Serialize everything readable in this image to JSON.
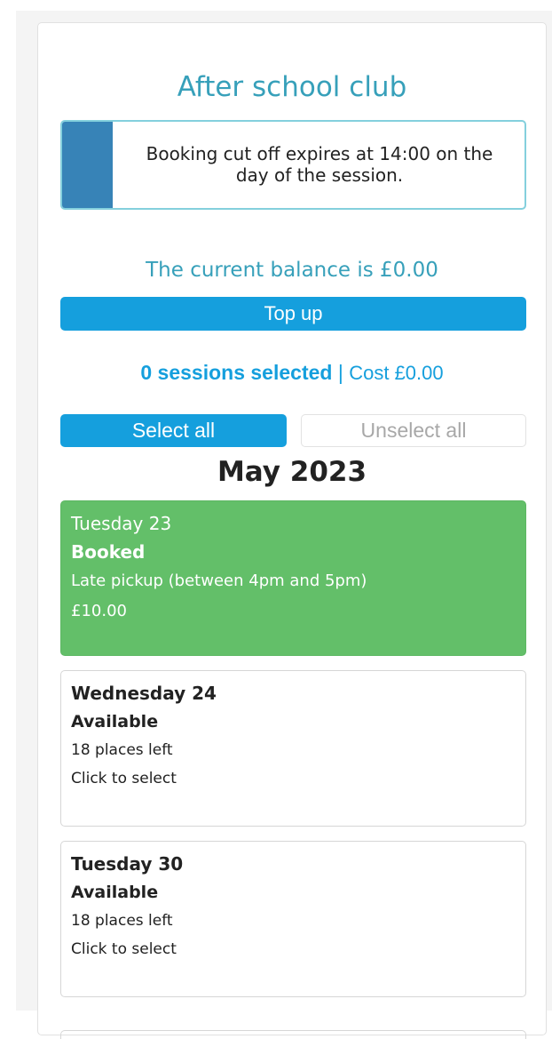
{
  "page": {
    "title": "After school club"
  },
  "notice": {
    "text": "Booking cut off expires at 14:00 on the day of the session."
  },
  "balance": {
    "text": "The current balance is £0.00",
    "topup_label": "Top up"
  },
  "summary": {
    "selected": "0 sessions selected",
    "separator": " | ",
    "cost": "Cost £0.00"
  },
  "actions": {
    "select_all": "Select all",
    "unselect_all": "Unselect all"
  },
  "month": "May 2023",
  "sessions": [
    {
      "day": "Tuesday 23",
      "status": "Booked",
      "detail": "Late pickup (between 4pm and 5pm)",
      "price": "£10.00"
    },
    {
      "day": "Wednesday 24",
      "status": "Available",
      "places": "18 places left",
      "hint": "Click to select"
    },
    {
      "day": "Tuesday 30",
      "status": "Available",
      "places": "18 places left",
      "hint": "Click to select"
    }
  ],
  "colors": {
    "accent": "#159fdd",
    "title_teal": "#37a0ba",
    "notice_stripe": "#3783b7",
    "notice_border": "#84d0dd",
    "booked_green": "#63bf69"
  }
}
